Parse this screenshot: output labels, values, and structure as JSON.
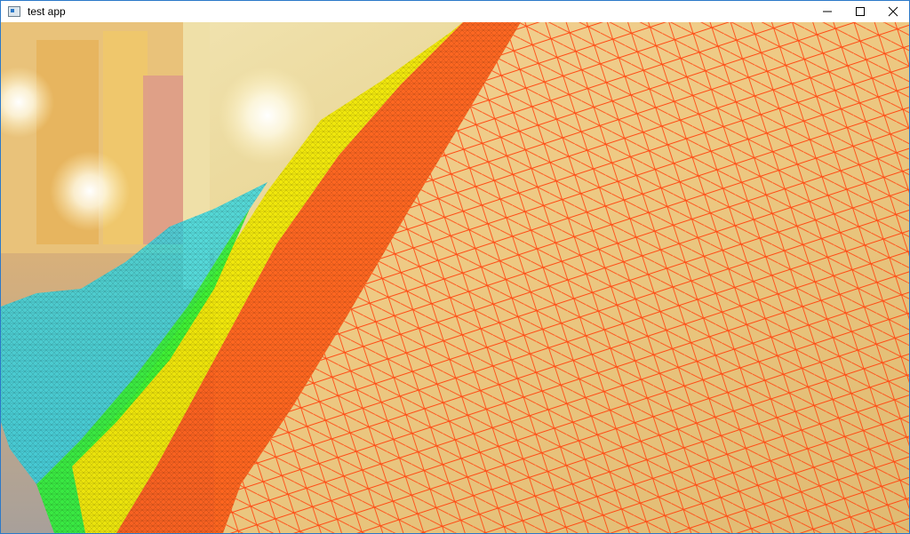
{
  "window": {
    "title": "test app"
  },
  "controls": {
    "minimize_icon": "minimize-icon",
    "maximize_icon": "maximize-icon",
    "close_icon": "close-icon"
  },
  "scene": {
    "mesh_colors": [
      "#22d6e8",
      "#2cf038",
      "#f0e800",
      "#ff5a14"
    ],
    "background_colors": [
      "#f4e2a0",
      "#d9c47a"
    ]
  }
}
